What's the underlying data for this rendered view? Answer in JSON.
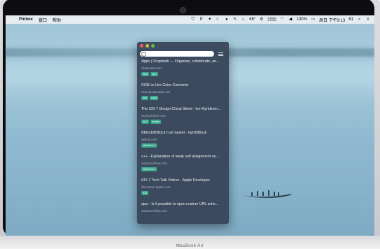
{
  "menubar": {
    "apple_glyph": "",
    "app_name": "Pinbox",
    "items": [
      "窗口",
      "帮助"
    ],
    "right": {
      "temperature": "66°",
      "network_up": "1.9KB/s",
      "network_down": "0.0KB/s",
      "battery": "100%",
      "datetime": "周日 下午9:13",
      "count": "61"
    }
  },
  "window": {
    "search": {
      "placeholder": "",
      "value": ""
    },
    "items": [
      {
        "title": "Apps | Dropmark — Organize, collaborate, an...",
        "url": "dropmark.com",
        "tags": [
          "mac",
          "app"
        ]
      },
      {
        "title": "RGB-to-Hex Color Converter",
        "url": "www.javascripter.net",
        "tags": [
          "hex",
          "color"
        ]
      },
      {
        "title": "The iOS 7 Design Cheat Sheet - Ivo Mynttinen...",
        "url": "ivomynttinen.com",
        "tags": [
          "ios7",
          "design"
        ]
      },
      {
        "title": "BBlock/BBlock.h at master · kgn/BBlock",
        "url": "github.com",
        "tags": [
          "objective-c"
        ]
      },
      {
        "title": "c++ - Explanation of weak self assignment us...",
        "url": "stackoverflow.com",
        "tags": [
          "objective-c"
        ]
      },
      {
        "title": "iOS 7 Tech Talk Videos - Apple Developer",
        "url": "developer.apple.com",
        "tags": [
          "iOS"
        ]
      },
      {
        "title": "ajax - Is it possible to open custom URL sche...",
        "url": "stackoverflow.com",
        "tags": []
      }
    ]
  },
  "device_label": "MacBook Air",
  "colors": {
    "window_bg": "#3b4a5e",
    "tag_bg": "#3aa88e"
  }
}
